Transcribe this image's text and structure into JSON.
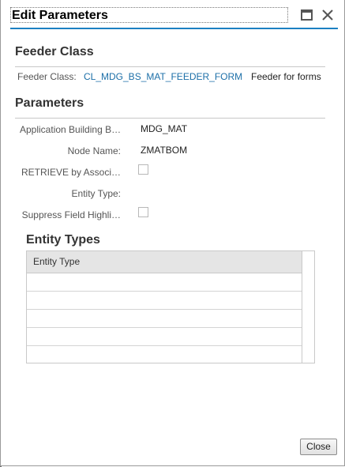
{
  "dialog": {
    "title": "Edit Parameters",
    "icons": {
      "maximize": "maximize-icon",
      "close": "close-x-icon"
    }
  },
  "feeder_section": {
    "title": "Feeder Class",
    "label": "Feeder Class:",
    "class_name": "CL_MDG_BS_MAT_FEEDER_FORM",
    "description": "Feeder for forms"
  },
  "parameters": {
    "title": "Parameters",
    "app_building_block": {
      "label": "Application Building B…",
      "value": "MDG_MAT"
    },
    "node_name": {
      "label": "Node Name:",
      "value": "ZMATBOM"
    },
    "retrieve_by_assoc": {
      "label": "RETRIEVE by Associ…",
      "checked": false
    },
    "entity_type": {
      "label": "Entity Type:",
      "value": ""
    },
    "suppress_field": {
      "label": "Suppress Field Highli…",
      "checked": false
    }
  },
  "entity_types": {
    "title": "Entity Types",
    "column_header": "Entity Type",
    "rows": [
      "",
      "",
      "",
      "",
      ""
    ]
  },
  "footer": {
    "close_label": "Close"
  },
  "colors": {
    "accent": "#1c80c2",
    "link": "#1c6fa8"
  }
}
